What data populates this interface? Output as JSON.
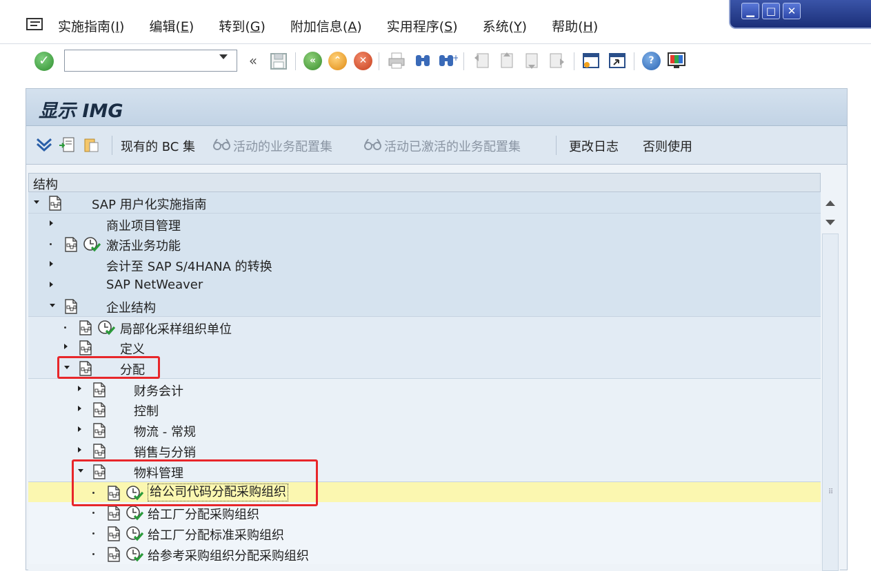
{
  "menubar": {
    "items": [
      {
        "label": "实施指南(",
        "key": "I",
        "end": ")"
      },
      {
        "label": "编辑(",
        "key": "E",
        "end": ")"
      },
      {
        "label": "转到(",
        "key": "G",
        "end": ")"
      },
      {
        "label": "附加信息(",
        "key": "A",
        "end": ")"
      },
      {
        "label": "实用程序(",
        "key": "S",
        "end": ")"
      },
      {
        "label": "系统(",
        "key": "Y",
        "end": ")"
      },
      {
        "label": "帮助(",
        "key": "H",
        "end": ")"
      }
    ]
  },
  "window_controls": {
    "minimize": "▁",
    "maximize": "□",
    "close": "✕"
  },
  "toolbar": {
    "command_value": "",
    "back_glyph": "«"
  },
  "page": {
    "title": "显示 IMG"
  },
  "app_toolbar": {
    "existing_bc_sets": "现有的 BC 集",
    "active_bc_sets": "活动的业务配置集",
    "activated_bc_sets": "活动已激活的业务配置集",
    "change_log": "更改日志",
    "otherwise_use": "否则使用"
  },
  "tree": {
    "header": "结构",
    "rows": [
      {
        "label": "SAP 用户化实施指南"
      },
      {
        "label": "商业项目管理"
      },
      {
        "label": "激活业务功能"
      },
      {
        "label": "会计至 SAP S/4HANA 的转换"
      },
      {
        "label": "SAP NetWeaver"
      },
      {
        "label": "企业结构"
      },
      {
        "label": "局部化采样组织单位"
      },
      {
        "label": "定义"
      },
      {
        "label": "分配"
      },
      {
        "label": "财务会计"
      },
      {
        "label": "控制"
      },
      {
        "label": "物流 - 常规"
      },
      {
        "label": "销售与分销"
      },
      {
        "label": "物料管理"
      },
      {
        "label": "给公司代码分配采购组织"
      },
      {
        "label": "给工厂分配采购组织"
      },
      {
        "label": "给工厂分配标准采购组织"
      },
      {
        "label": "给参考采购组织分配采购组织"
      }
    ]
  },
  "colors": {
    "annotation": "#e8262a",
    "highlight_row": "#fbf7b0"
  }
}
